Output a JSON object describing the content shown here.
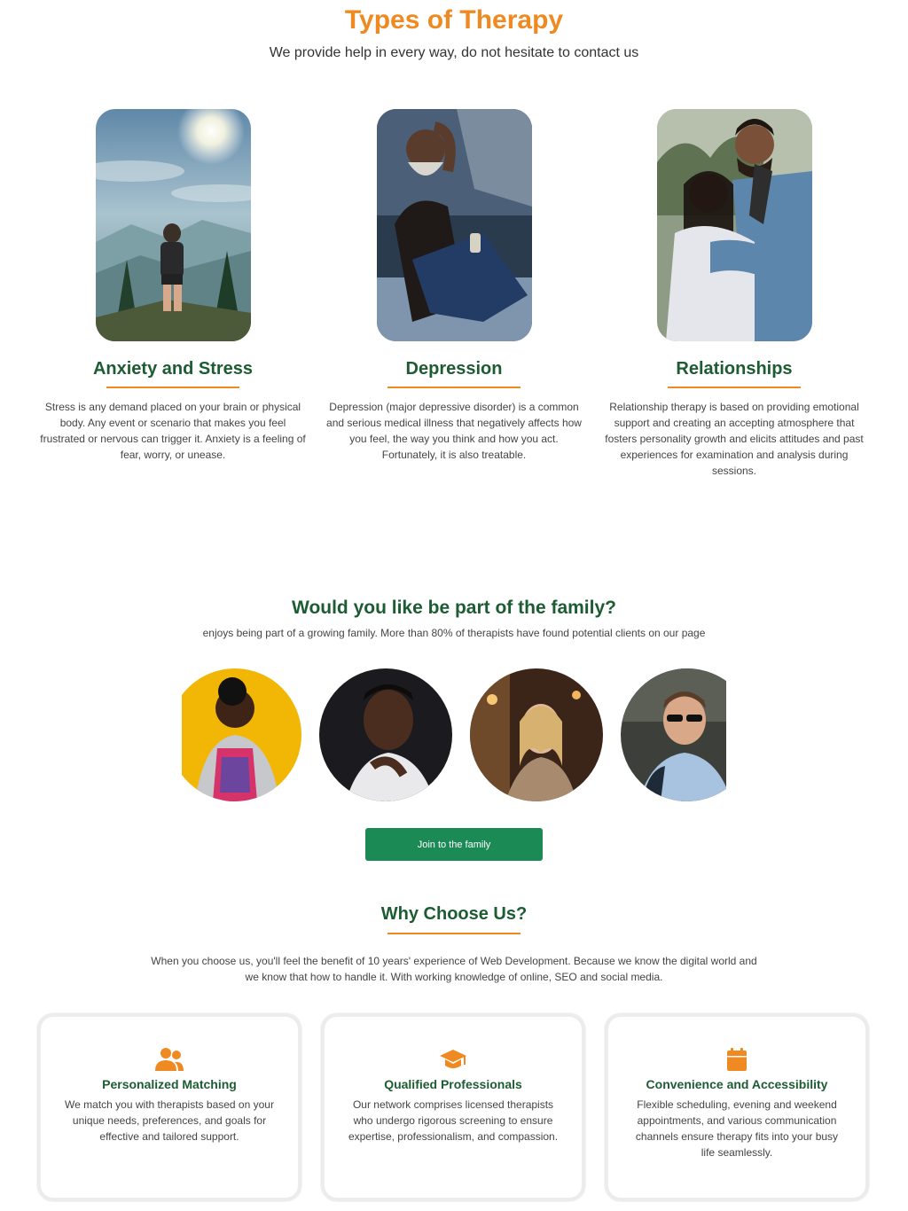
{
  "hero": {
    "title": "Types of Therapy",
    "subtitle": "We provide help in every way, do not hesitate to contact us"
  },
  "therapies": [
    {
      "title": "Anxiety and Stress",
      "text": "Stress is any demand placed on your brain or physical body. Any event or scenario that makes you feel frustrated or nervous can trigger it. Anxiety is a feeling of fear, worry, or unease.",
      "image": "hiker-on-mountain"
    },
    {
      "title": "Depression",
      "text": "Depression (major depressive disorder) is a common and serious medical illness that negatively affects how you feel, the way you think and how you act. Fortunately, it is also treatable.",
      "image": "man-sitting-distressed"
    },
    {
      "title": "Relationships",
      "text": "Relationship therapy is based on providing emotional support and creating an accepting atmosphere that fosters personality growth and elicits attitudes and past experiences for examination and analysis during sessions.",
      "image": "couple-embracing"
    }
  ],
  "family": {
    "title": "Would you like be part of the family?",
    "subtitle": "enjoys being part of a growing family. More than 80% of therapists have found potential clients on our page",
    "button_label": "Join to the family"
  },
  "why": {
    "title": "Why Choose Us?",
    "text": "When you choose us, you'll feel the benefit of 10 years' experience of Web Development. Because we know the digital world and we know that how to handle it. With working knowledge of online, SEO and social media.",
    "cards": [
      {
        "icon": "users-icon",
        "title": "Personalized Matching",
        "text": "We match you with therapists based on your unique needs, preferences, and goals for effective and tailored support."
      },
      {
        "icon": "graduation-cap-icon",
        "title": "Qualified Professionals",
        "text": "Our network comprises licensed therapists who undergo rigorous screening to ensure expertise, professionalism, and compassion."
      },
      {
        "icon": "calendar-icon",
        "title": "Convenience and Accessibility",
        "text": "Flexible scheduling, evening and weekend appointments, and various communication channels ensure therapy fits into your busy life seamlessly."
      }
    ]
  },
  "colors": {
    "accent": "#ef8a22",
    "heading_green": "#1d5c33",
    "button_green": "#1c8a55"
  }
}
